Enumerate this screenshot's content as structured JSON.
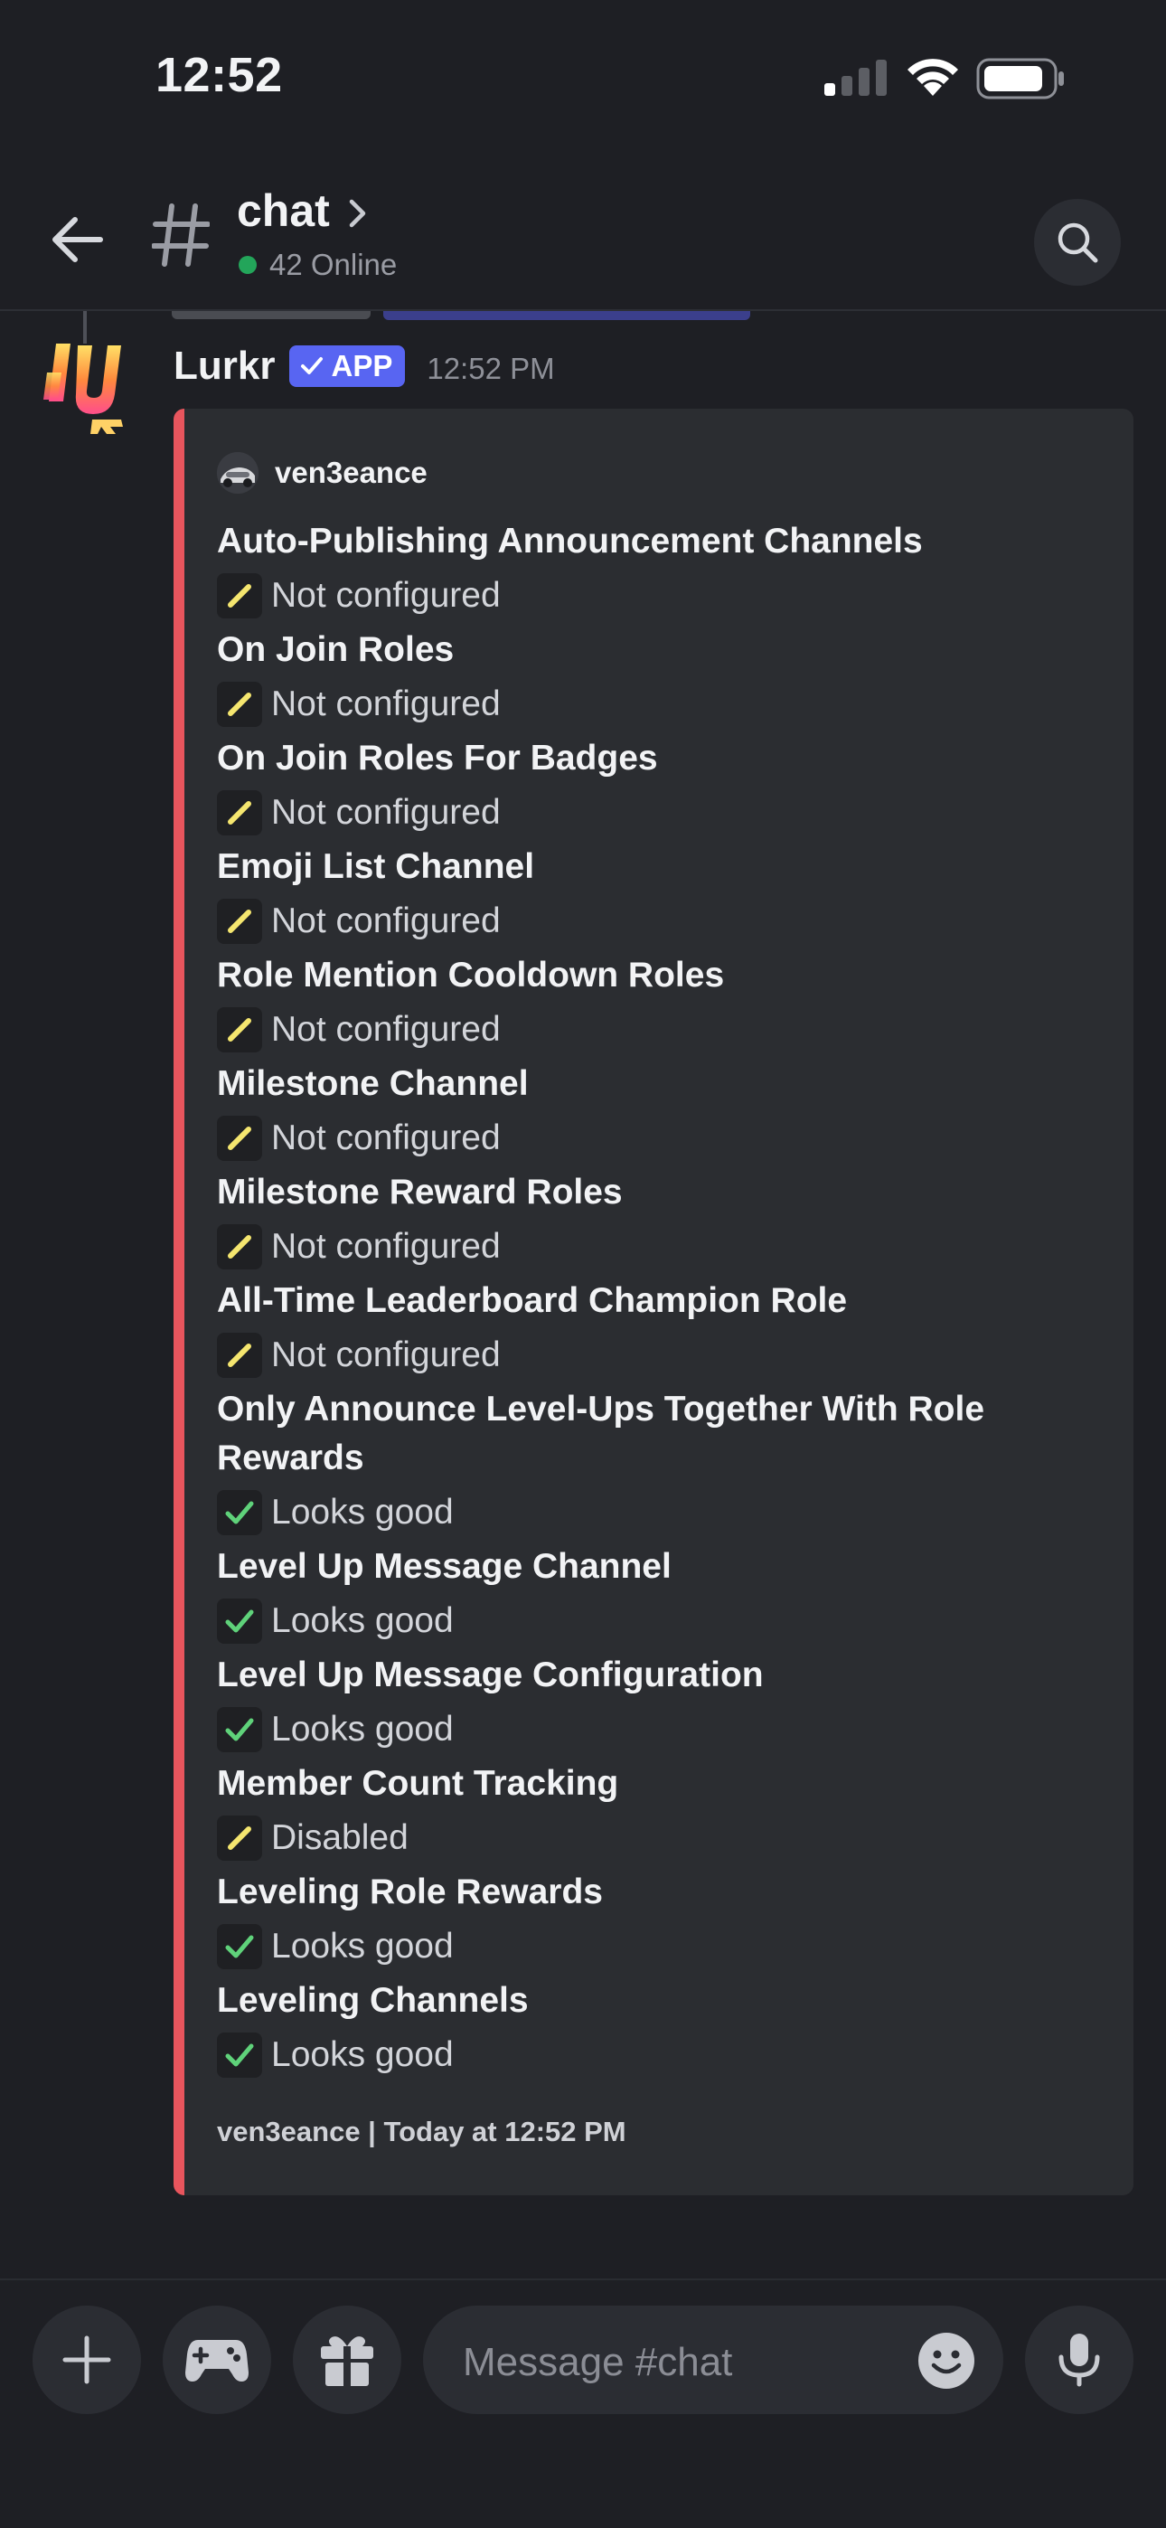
{
  "status_bar": {
    "time": "12:52"
  },
  "header": {
    "channel_name": "chat",
    "online_text": "42 Online"
  },
  "message": {
    "author": "Lurkr",
    "badge": "APP",
    "timestamp": "12:52 PM"
  },
  "embed": {
    "accent_color": "#e8555d",
    "author_name": "ven3eance",
    "fields": [
      {
        "name": "Auto-Publishing Announcement Channels",
        "icon": "pencil-icon",
        "value": "Not configured"
      },
      {
        "name": "On Join Roles",
        "icon": "pencil-icon",
        "value": "Not configured"
      },
      {
        "name": "On Join Roles For Badges",
        "icon": "pencil-icon",
        "value": "Not configured"
      },
      {
        "name": "Emoji List Channel",
        "icon": "pencil-icon",
        "value": "Not configured"
      },
      {
        "name": "Role Mention Cooldown Roles",
        "icon": "pencil-icon",
        "value": "Not configured"
      },
      {
        "name": "Milestone Channel",
        "icon": "pencil-icon",
        "value": "Not configured"
      },
      {
        "name": "Milestone Reward Roles",
        "icon": "pencil-icon",
        "value": "Not configured"
      },
      {
        "name": "All-Time Leaderboard Champion Role",
        "icon": "pencil-icon",
        "value": "Not configured"
      },
      {
        "name": "Only Announce Level-Ups Together With Role Rewards",
        "icon": "check-icon",
        "value": "Looks good"
      },
      {
        "name": "Level Up Message Channel",
        "icon": "check-icon",
        "value": "Looks good"
      },
      {
        "name": "Level Up Message Configuration",
        "icon": "check-icon",
        "value": "Looks good"
      },
      {
        "name": "Member Count Tracking",
        "icon": "pencil-icon",
        "value": "Disabled"
      },
      {
        "name": "Leveling Role Rewards",
        "icon": "check-icon",
        "value": "Looks good"
      },
      {
        "name": "Leveling Channels",
        "icon": "check-icon",
        "value": "Looks good"
      }
    ],
    "footer": "ven3eance | Today at 12:52 PM"
  },
  "composer": {
    "placeholder": "Message #chat"
  },
  "colors": {
    "background": "#1e1f24",
    "embed_background": "#2b2d31",
    "app_badge": "#5865f2",
    "online": "#23a55a",
    "pencil": "#f5e66f",
    "check": "#5fd27a"
  }
}
